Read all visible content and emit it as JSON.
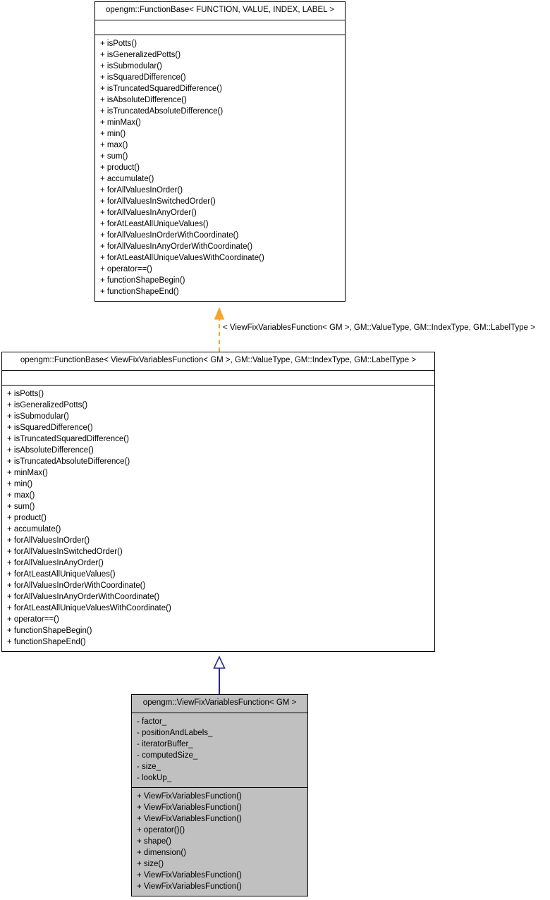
{
  "diagram": {
    "type": "uml-class-diagram",
    "title": "opengm::ViewFixVariablesFunction< GM > inheritance diagram",
    "background": "#ffffff",
    "colors": {
      "box_border": "#000000",
      "box_fill": "#ffffff",
      "highlight_fill": "#c0c0c0",
      "template_edge": "#f5a623",
      "inheritance_edge": "#2a2a8c",
      "text": "#000000"
    }
  },
  "classes": {
    "base_template": {
      "name": "opengm::FunctionBase< FUNCTION, VALUE, INDEX, LABEL >",
      "attributes": [],
      "methods": [
        "+ isPotts()",
        "+ isGeneralizedPotts()",
        "+ isSubmodular()",
        "+ isSquaredDifference()",
        "+ isTruncatedSquaredDifference()",
        "+ isAbsoluteDifference()",
        "+ isTruncatedAbsoluteDifference()",
        "+ minMax()",
        "+ min()",
        "+ max()",
        "+ sum()",
        "+ product()",
        "+ accumulate()",
        "+ forAllValuesInOrder()",
        "+ forAllValuesInSwitchedOrder()",
        "+ forAllValuesInAnyOrder()",
        "+ forAtLeastAllUniqueValues()",
        "+ forAllValuesInOrderWithCoordinate()",
        "+ forAllValuesInAnyOrderWithCoordinate()",
        "+ forAtLeastAllUniqueValuesWithCoordinate()",
        "+ operator==()",
        "+ functionShapeBegin()",
        "+ functionShapeEnd()"
      ]
    },
    "base_instantiated": {
      "name": "opengm::FunctionBase< ViewFixVariablesFunction< GM >, GM::ValueType, GM::IndexType, GM::LabelType >",
      "attributes": [],
      "methods": [
        "+ isPotts()",
        "+ isGeneralizedPotts()",
        "+ isSubmodular()",
        "+ isSquaredDifference()",
        "+ isTruncatedSquaredDifference()",
        "+ isAbsoluteDifference()",
        "+ isTruncatedAbsoluteDifference()",
        "+ minMax()",
        "+ min()",
        "+ max()",
        "+ sum()",
        "+ product()",
        "+ accumulate()",
        "+ forAllValuesInOrder()",
        "+ forAllValuesInSwitchedOrder()",
        "+ forAllValuesInAnyOrder()",
        "+ forAtLeastAllUniqueValues()",
        "+ forAllValuesInOrderWithCoordinate()",
        "+ forAllValuesInAnyOrderWithCoordinate()",
        "+ forAtLeastAllUniqueValuesWithCoordinate()",
        "+ operator==()",
        "+ functionShapeBegin()",
        "+ functionShapeEnd()"
      ]
    },
    "derived": {
      "name": "opengm::ViewFixVariablesFunction< GM >",
      "attributes": [
        "- factor_",
        "- positionAndLabels_",
        "- iteratorBuffer_",
        "- computedSize_",
        "- size_",
        "- lookUp_"
      ],
      "methods": [
        "+ ViewFixVariablesFunction()",
        "+ ViewFixVariablesFunction()",
        "+ ViewFixVariablesFunction()",
        "+ operator()()",
        "+ shape()",
        "+ dimension()",
        "+ size()",
        "+ ViewFixVariablesFunction()",
        "+ ViewFixVariablesFunction()"
      ]
    }
  },
  "edges": {
    "template_binding": {
      "label": "< ViewFixVariablesFunction< GM >, GM::ValueType, GM::IndexType, GM::LabelType >",
      "style": "dashed",
      "arrowhead": "filled-triangle",
      "color": "#f5a623"
    },
    "inheritance": {
      "label": "",
      "style": "solid",
      "arrowhead": "hollow-triangle",
      "color": "#2a2a8c"
    }
  }
}
